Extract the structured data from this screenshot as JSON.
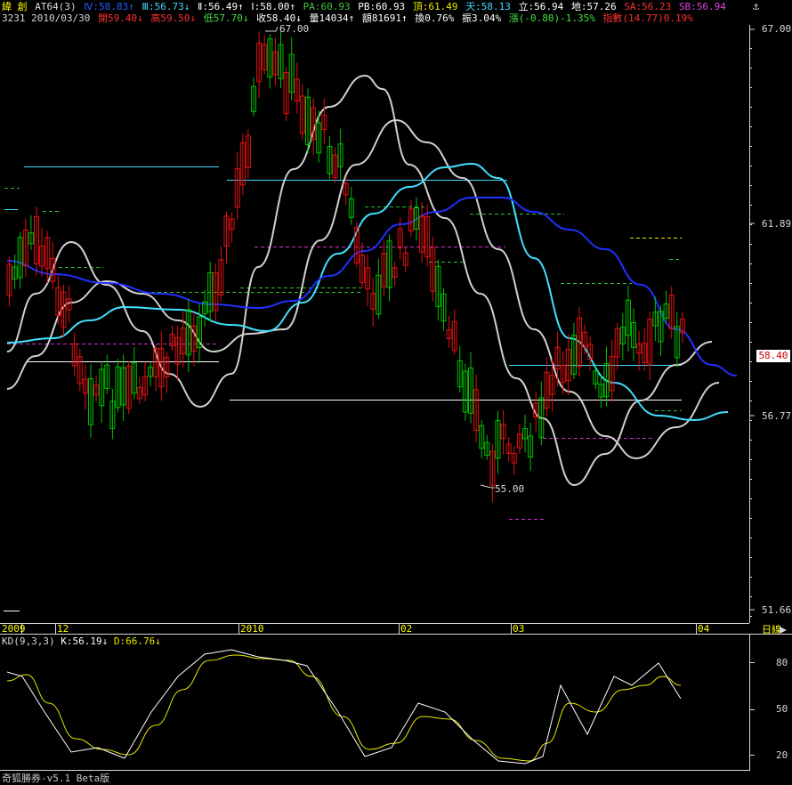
{
  "colors": {
    "bg": "#000000",
    "up": "#00c000",
    "down": "#e01010",
    "axis": "#d8d8d8",
    "ma_white": "#d0d0d0",
    "ma_cyan": "#40e0ff",
    "ma_blue": "#2020ff",
    "kd_k": "#ffffff",
    "kd_d": "#e8e800"
  },
  "header": {
    "stock_name": "緯  創",
    "indicator": "AT64(3)",
    "iv": "Ⅳ:58.83↑",
    "iii": "Ⅲ:56.73↓",
    "ii": "Ⅱ:56.49↑",
    "i": "Ⅰ:58.00↑",
    "pa": "PA:60.93",
    "pb": "PB:60.93",
    "ding": "頂:61.49",
    "tian": "天:58.13",
    "li": "立:56.94",
    "di": "地:57.26",
    "sa": "SA:56.23",
    "sb": "SB:56.94",
    "code_date": "3231 2010/03/30",
    "open": "開59.40↓",
    "high": "高59.50↓",
    "low": "低57.70↓",
    "close": "收58.40↓",
    "volume": "量14034↑",
    "amount": "額81691↑",
    "turnover": "換0.76%",
    "amplitude": "振3.04%",
    "change": "漲(-0.80)-1.35%",
    "index_change": "指數(14.77)0.19%"
  },
  "price_axis": {
    "ticks": [
      "67.00",
      "61.89",
      "56.77",
      "51.66"
    ],
    "current": "58.40"
  },
  "annotations": {
    "high": "67.00",
    "low": "55.00"
  },
  "time_axis": {
    "labels": [
      "2009",
      "12",
      "2010",
      "02",
      "03",
      "04"
    ],
    "period": "日線"
  },
  "kd": {
    "label": "KD(9,3,3)",
    "k": "K:56.19↓",
    "d": "D:66.76↓",
    "ticks": [
      "80",
      "50",
      "20"
    ]
  },
  "footer": "奇狐勝券-v5.1 Beta版",
  "icons": {
    "pin": "anchor-icon",
    "scroll": "scroll-arrow-icon"
  }
}
